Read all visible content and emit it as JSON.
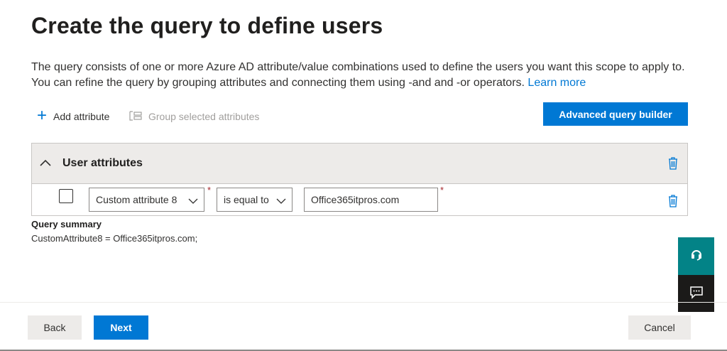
{
  "page": {
    "title": "Create the query to define users",
    "description": "The query consists of one or more Azure AD attribute/value combinations used to define the users you want this scope to apply to. You can refine the query by grouping attributes and connecting them using -and and -or operators.",
    "learn_more": "Learn more"
  },
  "toolbar": {
    "add_attribute": "Add attribute",
    "group_selected": "Group selected attributes",
    "advanced_query_builder": "Advanced query builder"
  },
  "group": {
    "title": "User attributes",
    "rows": [
      {
        "selected": false,
        "attribute": "Custom attribute 8",
        "operator": "is equal to",
        "value": "Office365itpros.com",
        "required_marker": "*"
      }
    ]
  },
  "summary": {
    "title": "Query summary",
    "text": "CustomAttribute8 = Office365itpros.com;"
  },
  "footer": {
    "back": "Back",
    "next": "Next",
    "cancel": "Cancel"
  },
  "side_panel": {
    "icons": [
      "headset-icon",
      "chat-icon"
    ]
  },
  "colors": {
    "accent": "#0078d4",
    "side_top": "#038387",
    "side_bottom": "#1b1a19",
    "required": "#a4262c"
  }
}
